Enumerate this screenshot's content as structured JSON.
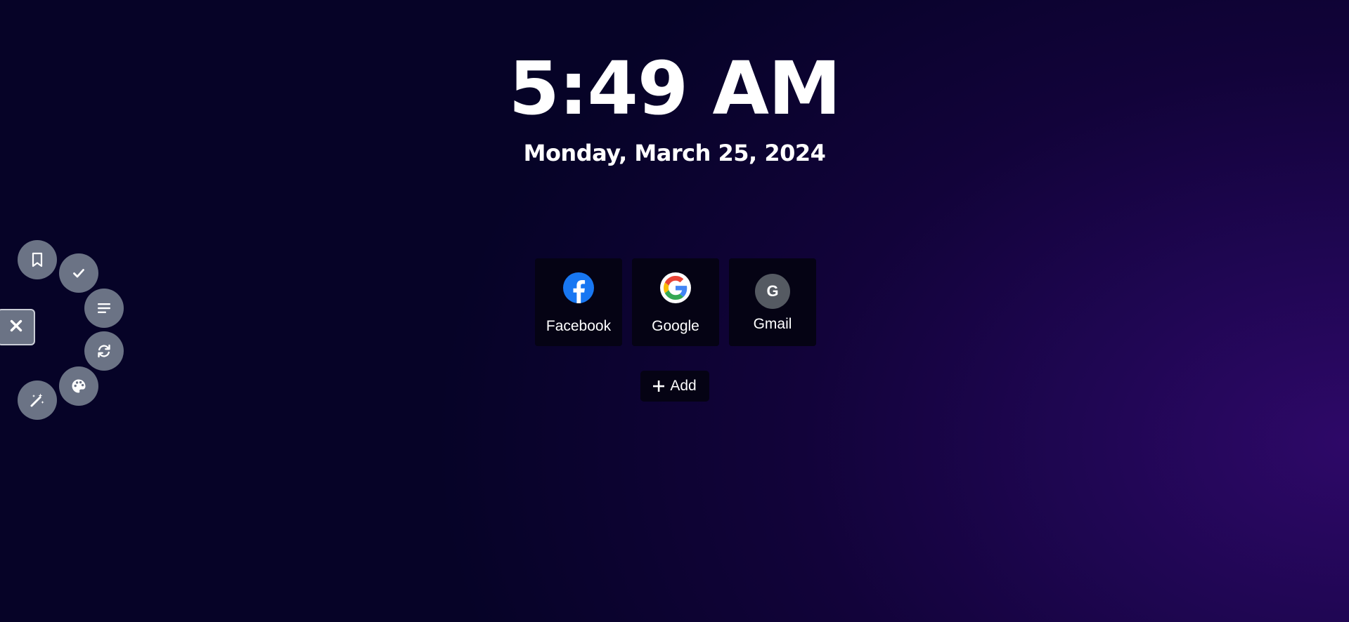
{
  "clock": {
    "time": "5:49 AM",
    "date": "Monday, March 25, 2024"
  },
  "shortcuts": [
    {
      "label": "Facebook",
      "icon": "facebook-icon"
    },
    {
      "label": "Google",
      "icon": "google-icon"
    },
    {
      "label": "Gmail",
      "icon": "letter-avatar",
      "letter": "G"
    }
  ],
  "add_button": {
    "label": "Add",
    "icon": "plus-icon"
  },
  "menu": {
    "items": [
      {
        "icon": "bookmark-icon"
      },
      {
        "icon": "check-icon"
      },
      {
        "icon": "lines-icon"
      },
      {
        "icon": "refresh-icon"
      },
      {
        "icon": "palette-icon"
      },
      {
        "icon": "magic-wand-icon"
      }
    ],
    "close_icon": "close-icon"
  },
  "colors": {
    "background": "#060327",
    "accent_gradient": "#2e0868",
    "tile_background": "#050314",
    "menu_button": "#6b7385",
    "facebook_blue": "#1877f2"
  }
}
